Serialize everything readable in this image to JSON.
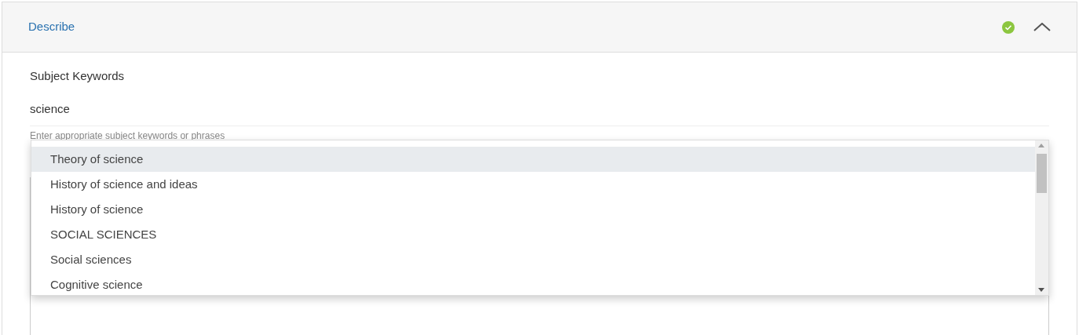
{
  "section": {
    "title": "Describe",
    "complete": true,
    "expanded": true
  },
  "field": {
    "label": "Subject Keywords",
    "value": "science",
    "hint": "Enter appropriate subject keywords or phrases"
  },
  "suggestions": [
    {
      "label": "Theory of science",
      "selected": true
    },
    {
      "label": "History of science and ideas",
      "selected": false
    },
    {
      "label": "History of science",
      "selected": false
    },
    {
      "label": "SOCIAL SCIENCES",
      "selected": false
    },
    {
      "label": "Social sciences",
      "selected": false
    },
    {
      "label": "Cognitive science",
      "selected": false
    }
  ]
}
